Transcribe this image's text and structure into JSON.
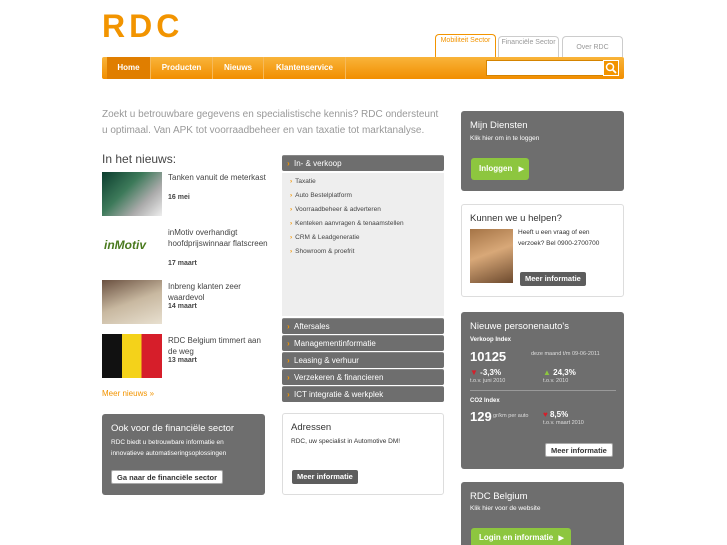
{
  "brand": {
    "logo_text": "RDC",
    "accent": "#f29400",
    "green": "#8dc63f"
  },
  "top_tabs": [
    {
      "label": "Mobiliteit Sector"
    },
    {
      "label": "Financiële Sector"
    },
    {
      "label": "Over RDC"
    }
  ],
  "nav": {
    "items": [
      "Home",
      "Producten",
      "Nieuws",
      "Klantenservice"
    ],
    "search_placeholder": ""
  },
  "intro": "Zoekt u betrouwbare gegevens en specialistische kennis? RDC ondersteunt u optimaal. Van APK tot voorraadbeheer en van taxatie tot marktanalyse.",
  "news": {
    "heading": "In het nieuws:",
    "items": [
      {
        "title": "Tanken vanuit de meterkast",
        "date": "16 mei"
      },
      {
        "title": "inMotiv overhandigt hoofdprijswinnaar flatscreen",
        "date": "17 maart"
      },
      {
        "title": "Inbreng klanten zeer waardevol",
        "date": "14 maart"
      },
      {
        "title": "RDC Belgium timmert aan de weg",
        "date": "13 maart"
      }
    ],
    "more": "Meer nieuws »",
    "inmotiv_logo": "inMotiv"
  },
  "categories": {
    "first": "In- & verkoop",
    "subitems": [
      "Taxatie",
      "Auto Bestelplatform",
      "Voorraadbeheer & adverteren",
      "Kenteken aanvragen & tenaamstellen",
      "CRM & Leadgeneratie",
      "Showroom & proefrit"
    ],
    "rest": [
      "Aftersales",
      "Managementinformatie",
      "Leasing & verhuur",
      "Verzekeren & financieren",
      "ICT integratie & werkplek"
    ]
  },
  "financial": {
    "title": "Ook voor de financiële sector",
    "text": "RDC biedt u betrouwbare informatie en innovatieve automatiseringsoplossingen",
    "button": "Ga naar de financiële sector"
  },
  "adressen": {
    "title": "Adressen",
    "text": "RDC, uw specialist in Automotive DM!",
    "button": "Meer informatie"
  },
  "diensten": {
    "title": "Mijn Diensten",
    "text": "Klik hier om in te loggen",
    "button": "Inloggen"
  },
  "help": {
    "title": "Kunnen we u helpen?",
    "text": "Heeft u een vraag of een verzoek? Bel 0900-2700700",
    "button": "Meer informatie"
  },
  "personenautos": {
    "title": "Nieuwe personenauto's",
    "verkoop_label": "Verkoop Index",
    "verkoop_value": "10125",
    "verkoop_desc": "deze maand t/m 09-06-2011",
    "down_value": "-3,3%",
    "down_desc": "t.o.v. juni 2010",
    "up_value": "24,3%",
    "up_desc": "t.o.v. 2010",
    "co2_label": "CO2 Index",
    "co2_value": "129",
    "co2_unit": "gr/km per auto",
    "co2_change": "8,5%",
    "co2_desc": "t.o.v. maart 2010",
    "button": "Meer informatie"
  },
  "belgium": {
    "title": "RDC Belgium",
    "text": "Klik hier voor de website",
    "button": "Login en informatie"
  }
}
